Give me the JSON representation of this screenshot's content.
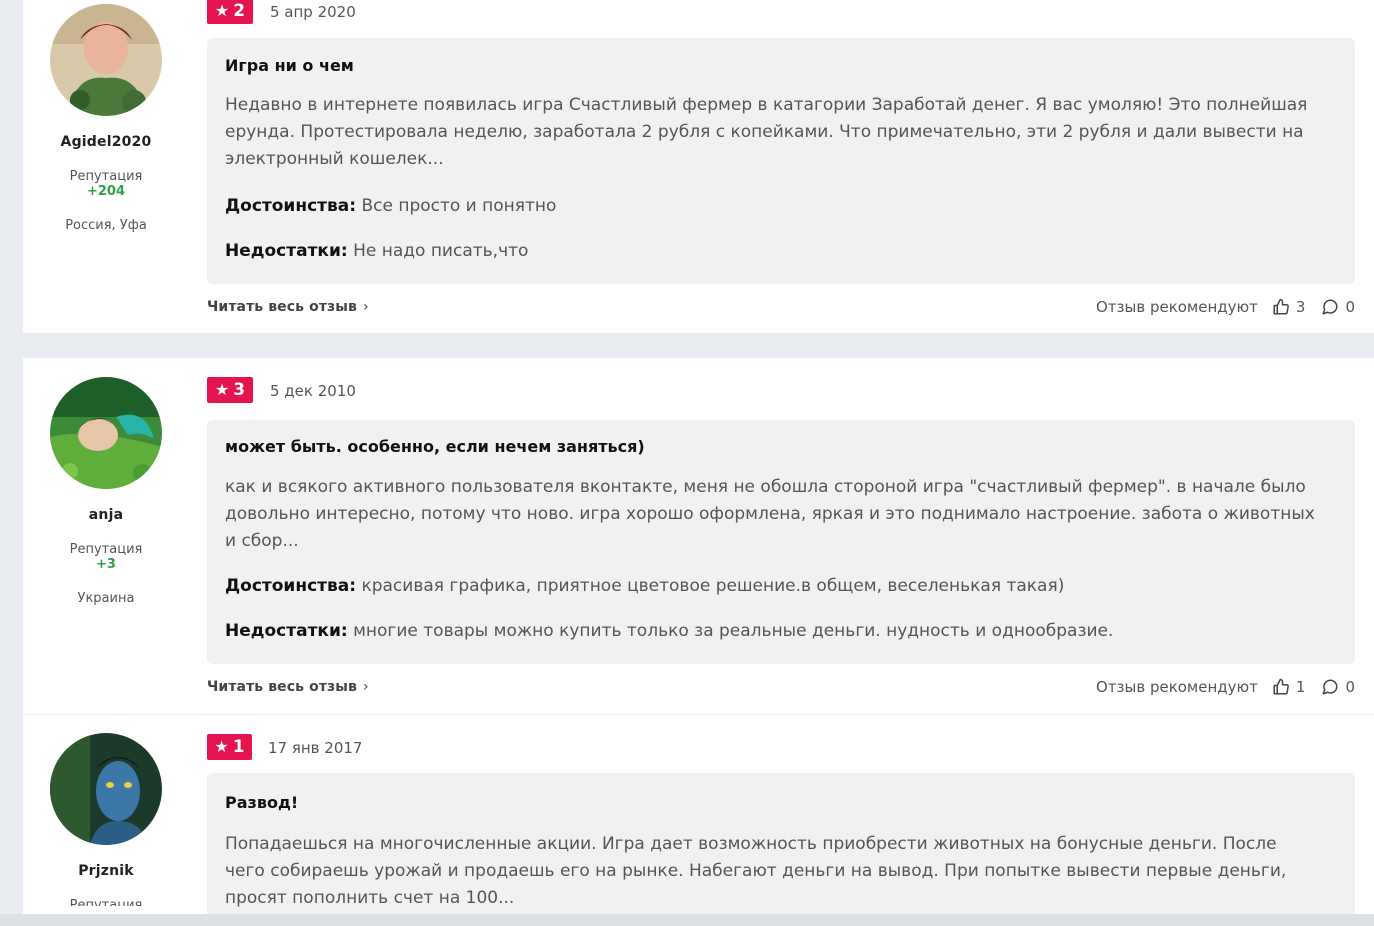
{
  "labels": {
    "reputation": "Репутация",
    "pros": "Достоинства:",
    "cons": "Недостатки:",
    "read_more": "Читать весь отзыв",
    "recommend": "Отзыв рекомендуют"
  },
  "reviews": [
    {
      "author": "Agidel2020",
      "reputation": "+204",
      "location": "Россия, Уфа",
      "rating": "2",
      "date": "5 апр 2020",
      "title": "Игра ни о чем",
      "text": "Недавно в интернете появилась игра Счастливый фермер в катагории Заработай денег. Я вас умоляю! Это полнейшая ерунда. Протестировала неделю, заработала 2 рубля с копейками. Что примечательно, эти 2 рубля и дали вывести на электронный кошелек...",
      "pros": "Все просто и понятно",
      "cons": "Не надо писать,что",
      "likes": "3",
      "comments": "0"
    },
    {
      "author": "anja",
      "reputation": "+3",
      "location": "Украина",
      "rating": "3",
      "date": "5 дек 2010",
      "title": "может быть. особенно, если нечем заняться)",
      "text": "как и всякого активного пользователя вконтакте, меня не обошла стороной игра \"счастливый фермер\". в начале было довольно интересно, потому что ново. игра хорошо оформлена, яркая и это поднимало настроение. забота о животных и сбор...",
      "pros": "красивая графика, приятное цветовое решение.в общем, веселенькая такая)",
      "cons": "многие товары можно купить только за реальные деньги. нудность и однообразие.",
      "likes": "1",
      "comments": "0"
    },
    {
      "author": "Prjznik",
      "rating": "1",
      "date": "17 янв 2017",
      "title": "Развод!",
      "text": "Попадаешься на многочисленные акции. Игра дает возможность приобрести животных на бонусные деньги. После чего собираешь урожай и продаешь его на рынке. Набегают деньги на вывод. При попытке вывести первые деньги, просят пополнить счет на 100..."
    }
  ]
}
